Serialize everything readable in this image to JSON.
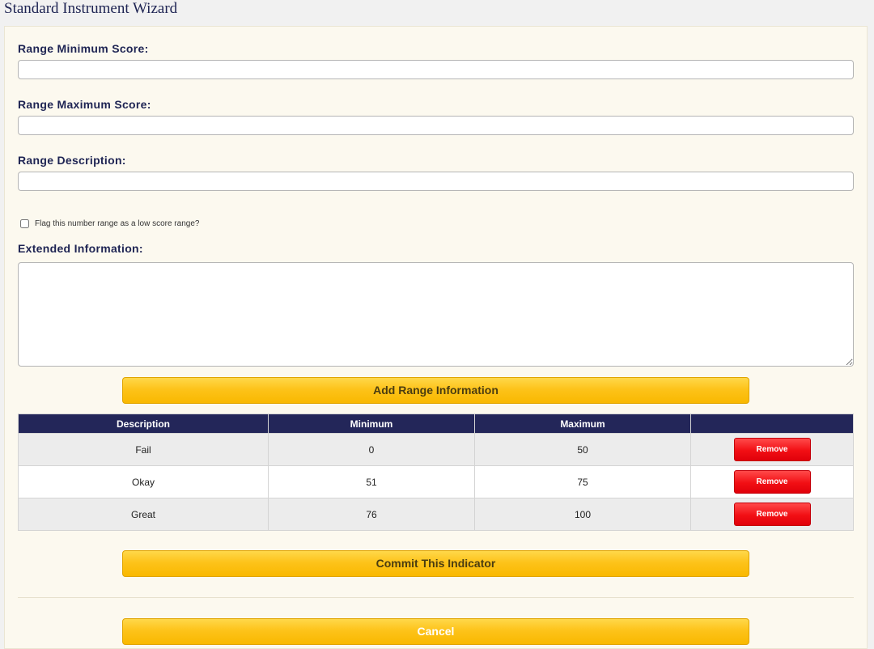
{
  "page": {
    "title": "Standard Instrument Wizard"
  },
  "form": {
    "min_label": "Range Minimum Score:",
    "min_value": "",
    "max_label": "Range Maximum Score:",
    "max_value": "",
    "desc_label": "Range Description:",
    "desc_value": "",
    "flag_label": "Flag this number range as a low score range?",
    "extended_label": "Extended Information:",
    "extended_value": ""
  },
  "buttons": {
    "add_range": "Add Range Information",
    "commit": "Commit This Indicator",
    "cancel": "Cancel"
  },
  "table": {
    "columns": [
      "Description",
      "Minimum",
      "Maximum",
      ""
    ],
    "rows": [
      {
        "description": "Fail",
        "minimum": "0",
        "maximum": "50",
        "action": "Remove"
      },
      {
        "description": "Okay",
        "minimum": "51",
        "maximum": "75",
        "action": "Remove"
      },
      {
        "description": "Great",
        "minimum": "76",
        "maximum": "100",
        "action": "Remove"
      }
    ]
  },
  "colors": {
    "header_bg": "#232659",
    "accent_gold": "#fdc31a",
    "remove_red": "#f20f14",
    "panel_bg": "#fcf9ef"
  }
}
